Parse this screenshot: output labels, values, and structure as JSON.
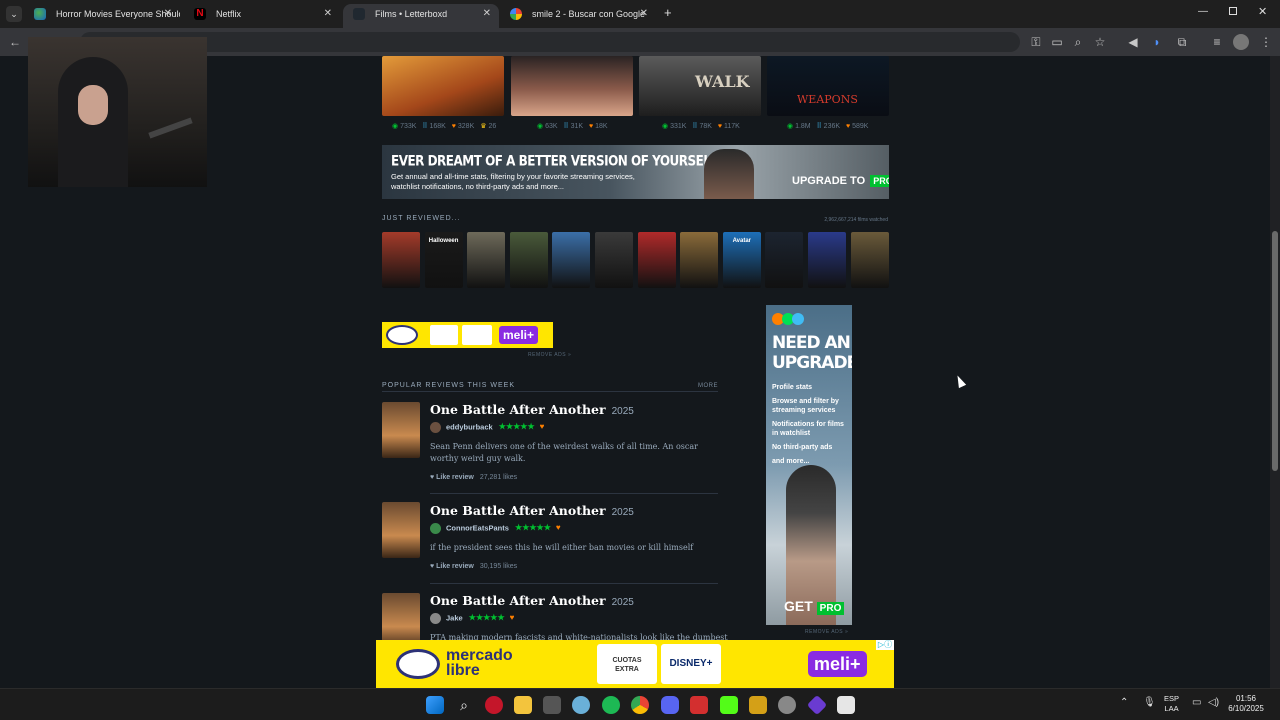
{
  "tabs": [
    {
      "label": "Horror Movies Everyone Shoulc",
      "icon": "globe-icon"
    },
    {
      "label": "Netflix",
      "icon": "netflix-icon"
    },
    {
      "label": "Films • Letterboxd",
      "icon": "letterboxd-icon",
      "active": true
    },
    {
      "label": "smile 2 - Buscar con Google",
      "icon": "google-icon"
    }
  ],
  "top_films": [
    {
      "views": "733K",
      "lists": "168K",
      "likes": "328K",
      "extra": "26"
    },
    {
      "views": "63K",
      "lists": "31K",
      "likes": "18K"
    },
    {
      "views": "331K",
      "lists": "78K",
      "likes": "117K"
    },
    {
      "views": "1.8M",
      "lists": "236K",
      "likes": "589K"
    }
  ],
  "poster_texts": {
    "walk": "WALK",
    "weapons": "WEAPONS"
  },
  "pro_banner": {
    "headline": "EVER DREAMT OF A BETTER VERSION OF YOURSELF?",
    "body": "Get annual and all-time stats, filtering by your favorite streaming services, watchlist notifications, no third-party ads and more...",
    "cta": "UPGRADE TO",
    "cta_badge": "PRO"
  },
  "just_reviewed": {
    "heading": "JUST REVIEWED...",
    "count": "2,962,667,214 films watched",
    "posters": [
      "Halloween",
      "Avatar"
    ]
  },
  "ad_small": {
    "badge": "meli+",
    "remove": "REMOVE ADS »"
  },
  "popular": {
    "heading": "POPULAR REVIEWS THIS WEEK",
    "more": "MORE",
    "reviews": [
      {
        "title": "One Battle After Another",
        "year": "2025",
        "user": "eddyburback",
        "stars": "★★★★★",
        "body": "Sean Penn delivers one of the weirdest walks of all time. An oscar worthy weird guy walk.",
        "like_label": "Like review",
        "likes": "27,281 likes"
      },
      {
        "title": "One Battle After Another",
        "year": "2025",
        "user": "ConnorEatsPants",
        "stars": "★★★★★",
        "body": "if the president sees this he will either ban movies or kill himself",
        "like_label": "Like review",
        "likes": "30,195 likes"
      },
      {
        "title": "One Battle After Another",
        "year": "2025",
        "user": "Jake",
        "stars": "★★★★★",
        "body": "PTA making modern fascists and white-nationalists look like the dumbest"
      }
    ]
  },
  "side_ad": {
    "headline": "NEED AN UPGRADE?",
    "items": [
      "Profile stats",
      "Browse and filter by streaming services",
      "Notifications for films in watchlist",
      "No third-party ads",
      "and more..."
    ],
    "cta": "GET",
    "cta_badge": "PRO",
    "remove": "REMOVE ADS »"
  },
  "bottom_ad": {
    "brand_line1": "mercado",
    "brand_line2": "libre",
    "tile1_line1": "CUOTAS",
    "tile1_line2": "EXTRA",
    "tile2": "DISNEY+",
    "badge": "meli+"
  },
  "taskbar": {
    "lang1": "ESP",
    "lang2": "LAA",
    "time": "01:56",
    "date": "6/10/2025"
  }
}
